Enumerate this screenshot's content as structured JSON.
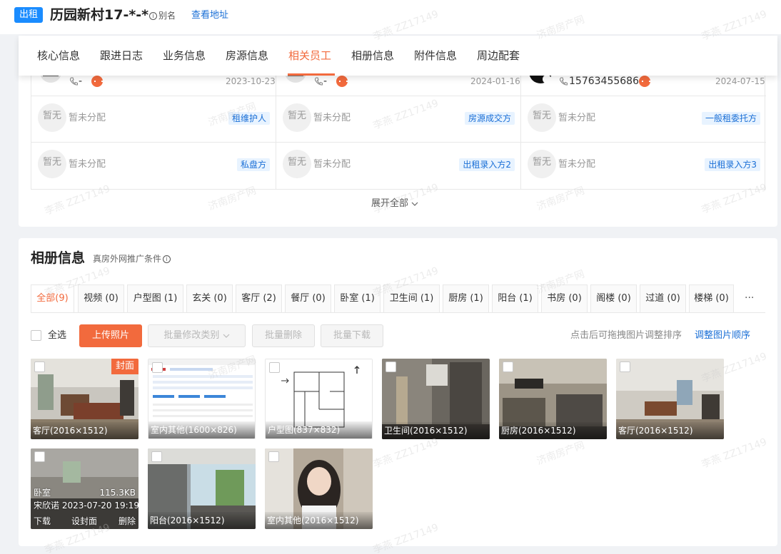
{
  "header": {
    "badge": "出租",
    "title": "历园新村17-*-*",
    "alias": "别名",
    "view_address": "查看地址"
  },
  "tabs": [
    {
      "label": "核心信息",
      "active": false
    },
    {
      "label": "跟进日志",
      "active": false
    },
    {
      "label": "业务信息",
      "active": false
    },
    {
      "label": "房源信息",
      "active": false
    },
    {
      "label": "相关员工",
      "active": true
    },
    {
      "label": "相册信息",
      "active": false
    },
    {
      "label": "附件信息",
      "active": false
    },
    {
      "label": "周边配套",
      "active": false
    }
  ],
  "staff": {
    "partial_row": [
      {
        "phone": "-",
        "date": "2023-10-23"
      },
      {
        "phone": "-",
        "date": "2024-01-16"
      },
      {
        "phone": "15763455686",
        "date": "2024-07-15"
      }
    ],
    "avatar_placeholder": "暂无",
    "rows": [
      [
        {
          "name": "暂未分配",
          "role": "租维护人"
        },
        {
          "name": "暂未分配",
          "role": "房源成交方"
        },
        {
          "name": "暂未分配",
          "role": "一般租委托方"
        }
      ],
      [
        {
          "name": "暂未分配",
          "role": "私盘方"
        },
        {
          "name": "暂未分配",
          "role": "出租录入方2"
        },
        {
          "name": "暂未分配",
          "role": "出租录入方3"
        }
      ]
    ],
    "expand_label": "展开全部"
  },
  "album": {
    "title": "相册信息",
    "subtitle": "真房外网推广条件",
    "categories": [
      {
        "label": "全部(9)",
        "active": true
      },
      {
        "label": "视频 (0)"
      },
      {
        "label": "户型图 (1)"
      },
      {
        "label": "玄关 (0)"
      },
      {
        "label": "客厅 (2)"
      },
      {
        "label": "餐厅 (0)"
      },
      {
        "label": "卧室 (1)"
      },
      {
        "label": "卫生间 (1)"
      },
      {
        "label": "厨房 (1)"
      },
      {
        "label": "阳台 (1)"
      },
      {
        "label": "书房 (0)"
      },
      {
        "label": "阁楼 (0)"
      },
      {
        "label": "过道 (0)"
      },
      {
        "label": "楼梯 (0)"
      }
    ],
    "more": "···",
    "select_all": "全选",
    "upload": "上传照片",
    "batch_type": "批量修改类别",
    "batch_delete": "批量删除",
    "batch_download": "批量下载",
    "hint": "点击后可拖拽图片调整排序",
    "reorder": "调整图片顺序",
    "cover_label": "封面",
    "photos": [
      {
        "label": "客厅(2016×1512)",
        "kind": "livingroom",
        "cover": true
      },
      {
        "label": "室内其他(1600×826)",
        "kind": "screenshot"
      },
      {
        "label": "户型图(837×832)",
        "kind": "floorplan"
      },
      {
        "label": "卫生间(2016×1512)",
        "kind": "bathroom"
      },
      {
        "label": "厨房(2016×1512)",
        "kind": "kitchen"
      },
      {
        "label": "客厅(2016×1512)",
        "kind": "livingroom2"
      },
      {
        "label": "",
        "kind": "bedroom",
        "hover": {
          "type": "卧室",
          "size": "115.3KB",
          "uploader": "宋欣诺 2023-07-20 19:19",
          "download": "下载",
          "set_cover": "设封面",
          "delete": "删除"
        }
      },
      {
        "label": "阳台(2016×1512)",
        "kind": "balcony"
      },
      {
        "label": "室内其他(2016×1512)",
        "kind": "selfie"
      }
    ]
  },
  "watermark": {
    "name": "李燕 ZZ17149",
    "company": "济南房产网"
  }
}
